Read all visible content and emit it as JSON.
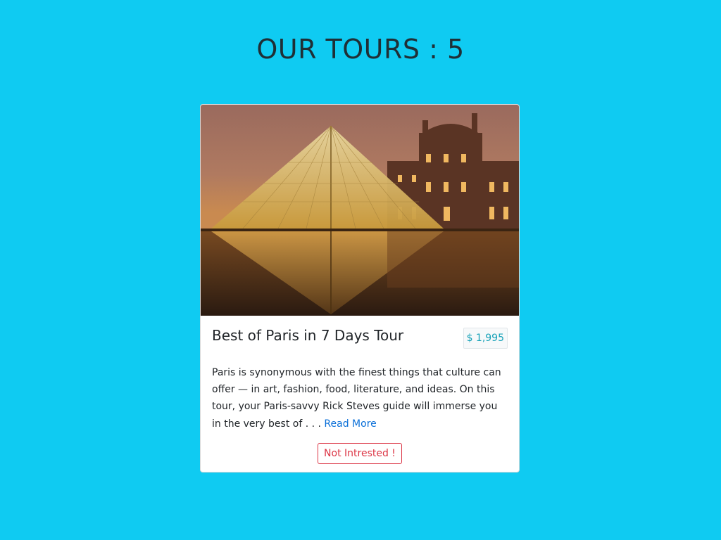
{
  "page": {
    "title": "OUR TOURS : 5",
    "background_color": "#0fcbf2"
  },
  "tour": {
    "image_subject": "Louvre pyramid in Paris at dusk",
    "name": "Best of Paris in 7 Days Tour",
    "price": "$ 1,995",
    "info": "Paris is synonymous with the finest things that culture can offer — in art, fashion, food, literature, and ideas. On this tour, your Paris-savvy Rick Steves guide will immerse you in the very best of . . . ",
    "read_more_label": "Read More",
    "not_interested_label": "Not Intrested !"
  },
  "colors": {
    "price": "#17a2b8",
    "link": "#0a6fd8",
    "danger": "#dc3545"
  }
}
